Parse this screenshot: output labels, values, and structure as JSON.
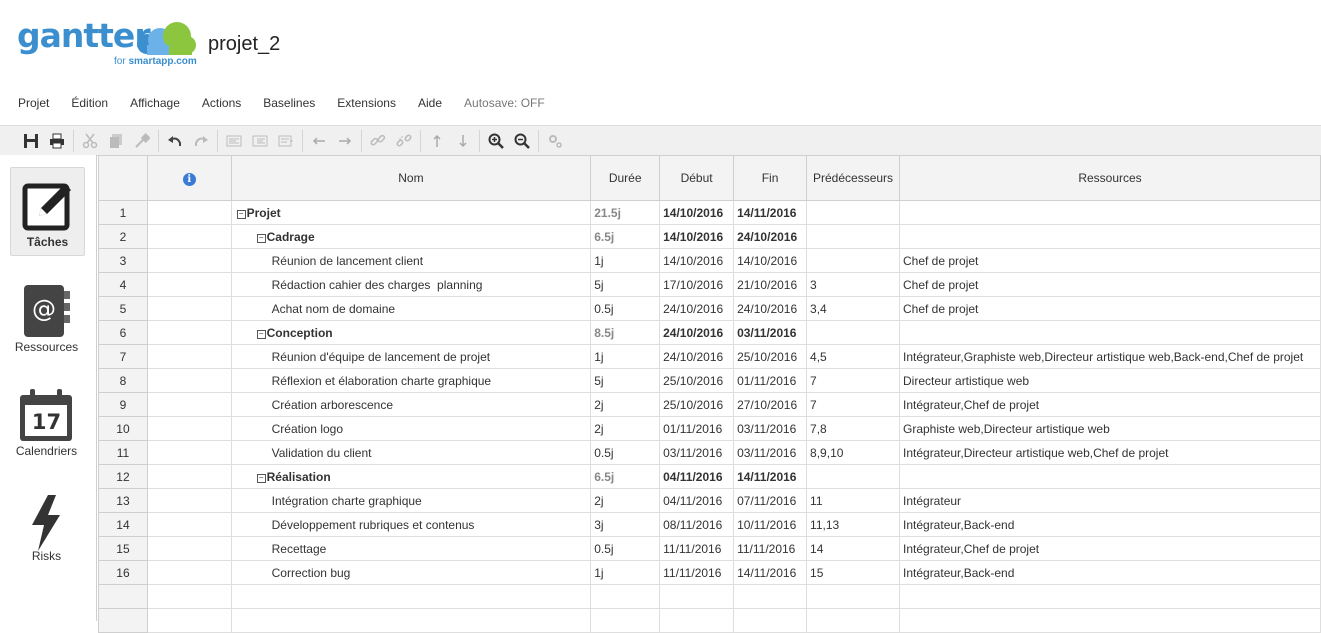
{
  "app": {
    "logo_text": "gantter",
    "logo_sub_prefix": "for ",
    "logo_sub_brand": "smartapp.com",
    "project_title": "projet_2"
  },
  "menu": {
    "items": [
      "Projet",
      "Édition",
      "Affichage",
      "Actions",
      "Baselines",
      "Extensions",
      "Aide"
    ],
    "autosave": "Autosave: OFF"
  },
  "toolbar": {
    "icons": [
      "save-icon",
      "print-icon",
      "cut-icon",
      "copy-icon",
      "paste-format-icon",
      "undo-icon",
      "redo-icon",
      "outdent-icon",
      "indent-icon",
      "task-icon",
      "arrow-left-icon",
      "arrow-right-icon",
      "link-icon",
      "unlink-icon",
      "arrow-up-icon",
      "arrow-down-icon",
      "zoom-in-icon",
      "zoom-out-icon",
      "settings-icon"
    ]
  },
  "sidebar": {
    "items": [
      {
        "label": "Tâches",
        "icon": "edit-icon",
        "active": true
      },
      {
        "label": "Ressources",
        "icon": "address-book-icon"
      },
      {
        "label": "Calendriers",
        "icon": "calendar-icon",
        "day": "17"
      },
      {
        "label": "Risks",
        "icon": "lightning-icon"
      }
    ]
  },
  "grid": {
    "columns": {
      "nom": "Nom",
      "duree": "Durée",
      "debut": "Début",
      "fin": "Fin",
      "pred": "Prédécesseurs",
      "res": "Ressources"
    },
    "rows": [
      {
        "id": "1",
        "name": "Projet",
        "level": 0,
        "summary": true,
        "duration": "21.5j",
        "start": "14/10/2016",
        "end": "14/11/2016",
        "pred": "",
        "res": ""
      },
      {
        "id": "2",
        "name": "Cadrage",
        "level": 1,
        "summary": true,
        "duration": "6.5j",
        "start": "14/10/2016",
        "end": "24/10/2016",
        "pred": "",
        "res": ""
      },
      {
        "id": "3",
        "name": "Réunion de lancement client",
        "level": 2,
        "summary": false,
        "duration": "1j",
        "start": "14/10/2016",
        "end": "14/10/2016",
        "pred": "",
        "res": "Chef de projet"
      },
      {
        "id": "4",
        "name": "Rédaction cahier des charges  planning",
        "level": 2,
        "summary": false,
        "duration": "5j",
        "start": "17/10/2016",
        "end": "21/10/2016",
        "pred": "3",
        "res": "Chef de projet"
      },
      {
        "id": "5",
        "name": "Achat nom de domaine",
        "level": 2,
        "summary": false,
        "duration": "0.5j",
        "start": "24/10/2016",
        "end": "24/10/2016",
        "pred": "3,4",
        "res": "Chef de projet"
      },
      {
        "id": "6",
        "name": "Conception",
        "level": 1,
        "summary": true,
        "duration": "8.5j",
        "start": "24/10/2016",
        "end": "03/11/2016",
        "pred": "",
        "res": ""
      },
      {
        "id": "7",
        "name": "Réunion d'équipe de lancement de projet",
        "level": 2,
        "summary": false,
        "duration": "1j",
        "start": "24/10/2016",
        "end": "25/10/2016",
        "pred": "4,5",
        "res": "Intégrateur,Graphiste web,Directeur artistique web,Back-end,Chef de projet"
      },
      {
        "id": "8",
        "name": "Réflexion et élaboration charte graphique",
        "level": 2,
        "summary": false,
        "duration": "5j",
        "start": "25/10/2016",
        "end": "01/11/2016",
        "pred": "7",
        "res": "Directeur artistique web"
      },
      {
        "id": "9",
        "name": "Création arborescence",
        "level": 2,
        "summary": false,
        "duration": "2j",
        "start": "25/10/2016",
        "end": "27/10/2016",
        "pred": "7",
        "res": "Intégrateur,Chef de projet"
      },
      {
        "id": "10",
        "name": "Création logo",
        "level": 2,
        "summary": false,
        "duration": "2j",
        "start": "01/11/2016",
        "end": "03/11/2016",
        "pred": "7,8",
        "res": "Graphiste web,Directeur artistique web"
      },
      {
        "id": "11",
        "name": "Validation du client",
        "level": 2,
        "summary": false,
        "duration": "0.5j",
        "start": "03/11/2016",
        "end": "03/11/2016",
        "pred": "8,9,10",
        "res": "Intégrateur,Directeur artistique web,Chef de projet"
      },
      {
        "id": "12",
        "name": "Réalisation",
        "level": 1,
        "summary": true,
        "duration": "6.5j",
        "start": "04/11/2016",
        "end": "14/11/2016",
        "pred": "",
        "res": ""
      },
      {
        "id": "13",
        "name": "Intégration charte graphique",
        "level": 2,
        "summary": false,
        "duration": "2j",
        "start": "04/11/2016",
        "end": "07/11/2016",
        "pred": "11",
        "res": "Intégrateur"
      },
      {
        "id": "14",
        "name": "Développement rubriques et contenus",
        "level": 2,
        "summary": false,
        "duration": "3j",
        "start": "08/11/2016",
        "end": "10/11/2016",
        "pred": "11,13",
        "res": "Intégrateur,Back-end"
      },
      {
        "id": "15",
        "name": "Recettage",
        "level": 2,
        "summary": false,
        "duration": "0.5j",
        "start": "11/11/2016",
        "end": "11/11/2016",
        "pred": "14",
        "res": "Intégrateur,Chef de projet"
      },
      {
        "id": "16",
        "name": "Correction bug",
        "level": 2,
        "summary": false,
        "duration": "1j",
        "start": "11/11/2016",
        "end": "14/11/2016",
        "pred": "15",
        "res": "Intégrateur,Back-end"
      }
    ]
  }
}
